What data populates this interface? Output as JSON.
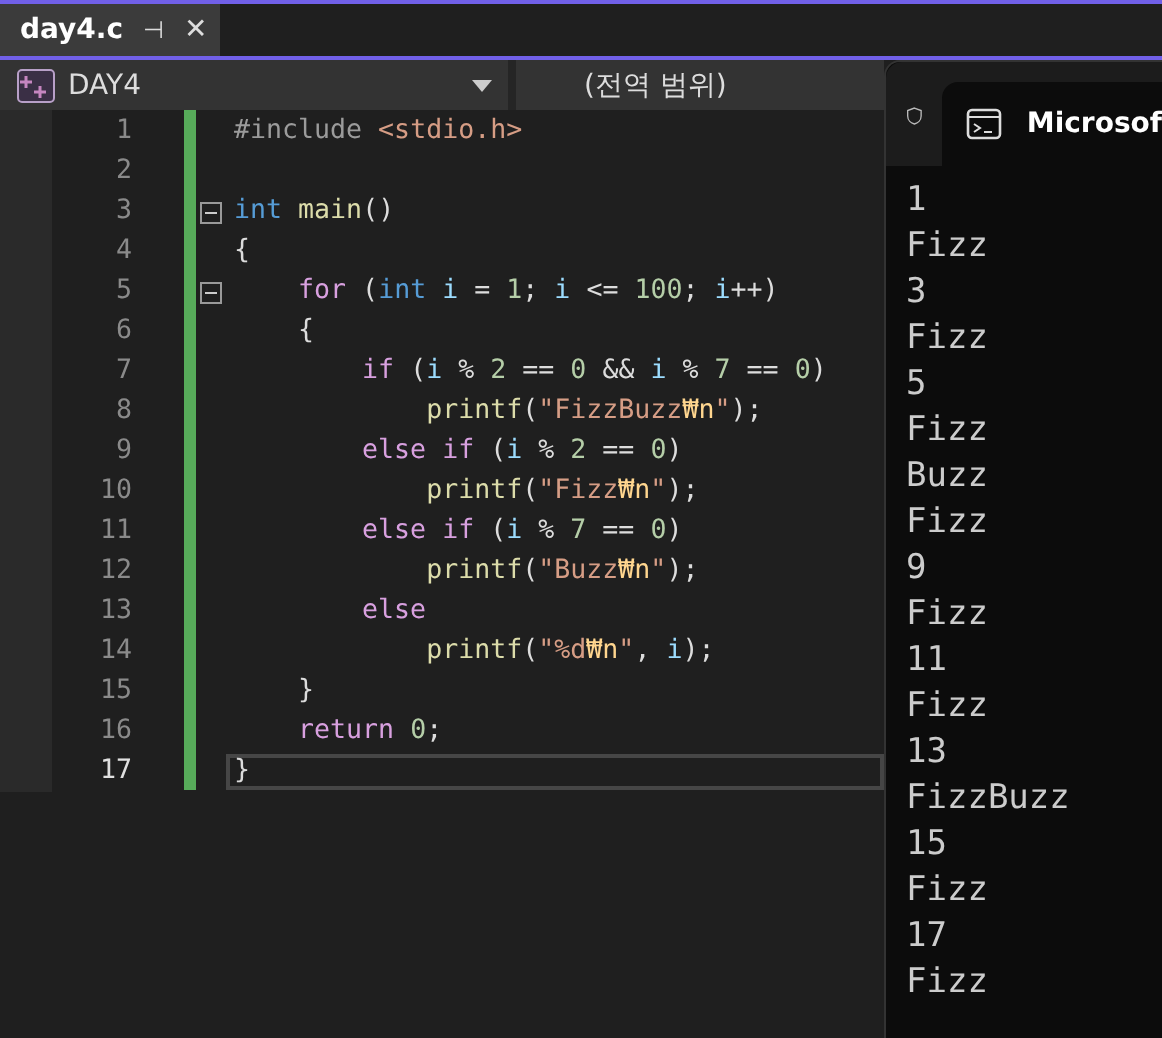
{
  "document_tab": {
    "title": "day4.c",
    "pin": "⊣",
    "close": "✕"
  },
  "nav_bar": {
    "project": "DAY4",
    "scope": "(전역 범위)"
  },
  "editor": {
    "lines": [
      {
        "number": "1",
        "fold": false,
        "current": false,
        "tokens": [
          {
            "kind": "pre",
            "text": "#include"
          },
          {
            "kind": "str",
            "text": " <stdio.h>"
          }
        ]
      },
      {
        "number": "2",
        "fold": false,
        "current": false
      },
      {
        "number": "3",
        "fold": true,
        "current": false,
        "tokens": [
          {
            "kind": "type",
            "text": "int"
          },
          {
            "kind": "fn",
            "text": " main"
          },
          {
            "kind": "plain",
            "text": "()"
          }
        ]
      },
      {
        "number": "4",
        "fold": false,
        "current": false,
        "tokens": [
          {
            "kind": "plain",
            "text": "{"
          }
        ]
      },
      {
        "number": "5",
        "fold": true,
        "current": false,
        "tokens": [
          {
            "kind": "kw",
            "text": "    for"
          },
          {
            "kind": "plain",
            "text": " ("
          },
          {
            "kind": "type",
            "text": "int"
          },
          {
            "kind": "var",
            "text": " i"
          },
          {
            "kind": "plain",
            "text": " = "
          },
          {
            "kind": "num",
            "text": "1"
          },
          {
            "kind": "plain",
            "text": "; "
          },
          {
            "kind": "var",
            "text": "i"
          },
          {
            "kind": "plain",
            "text": " <= "
          },
          {
            "kind": "num",
            "text": "100"
          },
          {
            "kind": "plain",
            "text": "; "
          },
          {
            "kind": "var",
            "text": "i"
          },
          {
            "kind": "plain",
            "text": "++)"
          }
        ]
      },
      {
        "number": "6",
        "fold": false,
        "current": false,
        "tokens": [
          {
            "kind": "plain",
            "text": "    {"
          }
        ]
      },
      {
        "number": "7",
        "fold": false,
        "current": false,
        "tokens": [
          {
            "kind": "kw",
            "text": "        if"
          },
          {
            "kind": "plain",
            "text": " ("
          },
          {
            "kind": "var",
            "text": "i"
          },
          {
            "kind": "plain",
            "text": " % "
          },
          {
            "kind": "num",
            "text": "2"
          },
          {
            "kind": "plain",
            "text": " == "
          },
          {
            "kind": "num",
            "text": "0"
          },
          {
            "kind": "plain",
            "text": " && "
          },
          {
            "kind": "var",
            "text": "i"
          },
          {
            "kind": "plain",
            "text": " % "
          },
          {
            "kind": "num",
            "text": "7"
          },
          {
            "kind": "plain",
            "text": " == "
          },
          {
            "kind": "num",
            "text": "0"
          },
          {
            "kind": "plain",
            "text": ")"
          }
        ]
      },
      {
        "number": "8",
        "fold": false,
        "current": false,
        "tokens": [
          {
            "kind": "fn",
            "text": "            printf"
          },
          {
            "kind": "plain",
            "text": "("
          },
          {
            "kind": "str",
            "text": "\"FizzBuzz"
          },
          {
            "kind": "esc",
            "text": "₩n"
          },
          {
            "kind": "str",
            "text": "\""
          },
          {
            "kind": "plain",
            "text": ");"
          }
        ]
      },
      {
        "number": "9",
        "fold": false,
        "current": false,
        "tokens": [
          {
            "kind": "kw",
            "text": "        else if"
          },
          {
            "kind": "plain",
            "text": " ("
          },
          {
            "kind": "var",
            "text": "i"
          },
          {
            "kind": "plain",
            "text": " % "
          },
          {
            "kind": "num",
            "text": "2"
          },
          {
            "kind": "plain",
            "text": " == "
          },
          {
            "kind": "num",
            "text": "0"
          },
          {
            "kind": "plain",
            "text": ")"
          }
        ]
      },
      {
        "number": "10",
        "fold": false,
        "current": false,
        "tokens": [
          {
            "kind": "fn",
            "text": "            printf"
          },
          {
            "kind": "plain",
            "text": "("
          },
          {
            "kind": "str",
            "text": "\"Fizz"
          },
          {
            "kind": "esc",
            "text": "₩n"
          },
          {
            "kind": "str",
            "text": "\""
          },
          {
            "kind": "plain",
            "text": ");"
          }
        ]
      },
      {
        "number": "11",
        "fold": false,
        "current": false,
        "tokens": [
          {
            "kind": "kw",
            "text": "        else if"
          },
          {
            "kind": "plain",
            "text": " ("
          },
          {
            "kind": "var",
            "text": "i"
          },
          {
            "kind": "plain",
            "text": " % "
          },
          {
            "kind": "num",
            "text": "7"
          },
          {
            "kind": "plain",
            "text": " == "
          },
          {
            "kind": "num",
            "text": "0"
          },
          {
            "kind": "plain",
            "text": ")"
          }
        ]
      },
      {
        "number": "12",
        "fold": false,
        "current": false,
        "tokens": [
          {
            "kind": "fn",
            "text": "            printf"
          },
          {
            "kind": "plain",
            "text": "("
          },
          {
            "kind": "str",
            "text": "\"Buzz"
          },
          {
            "kind": "esc",
            "text": "₩n"
          },
          {
            "kind": "str",
            "text": "\""
          },
          {
            "kind": "plain",
            "text": ");"
          }
        ]
      },
      {
        "number": "13",
        "fold": false,
        "current": false,
        "tokens": [
          {
            "kind": "kw",
            "text": "        else"
          }
        ]
      },
      {
        "number": "14",
        "fold": false,
        "current": false,
        "tokens": [
          {
            "kind": "fn",
            "text": "            printf"
          },
          {
            "kind": "plain",
            "text": "("
          },
          {
            "kind": "str",
            "text": "\"%d"
          },
          {
            "kind": "esc",
            "text": "₩n"
          },
          {
            "kind": "str",
            "text": "\""
          },
          {
            "kind": "plain",
            "text": ", "
          },
          {
            "kind": "var",
            "text": "i"
          },
          {
            "kind": "plain",
            "text": ");"
          }
        ]
      },
      {
        "number": "15",
        "fold": false,
        "current": false,
        "tokens": [
          {
            "kind": "plain",
            "text": "    }"
          }
        ]
      },
      {
        "number": "16",
        "fold": false,
        "current": false,
        "tokens": [
          {
            "kind": "kw",
            "text": "    return"
          },
          {
            "kind": "num",
            "text": " 0"
          },
          {
            "kind": "plain",
            "text": ";"
          }
        ]
      },
      {
        "number": "17",
        "fold": false,
        "current": true,
        "tokens": [
          {
            "kind": "plain",
            "text": "}"
          }
        ]
      }
    ]
  },
  "terminal": {
    "tab_title": "Microsof",
    "output": [
      "1",
      "Fizz",
      "3",
      "Fizz",
      "5",
      "Fizz",
      "Buzz",
      "Fizz",
      "9",
      "Fizz",
      "11",
      "Fizz",
      "13",
      "FizzBuzz",
      "15",
      "Fizz",
      "17",
      "Fizz"
    ]
  }
}
